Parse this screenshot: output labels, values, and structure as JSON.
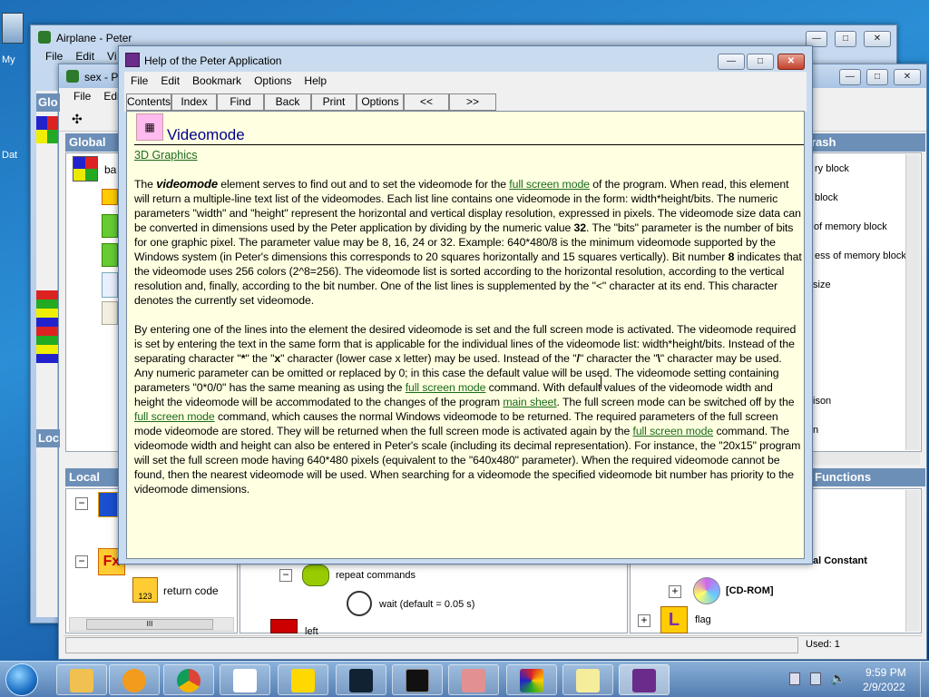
{
  "desktop": {
    "icon1": "My",
    "icon2": "Dat"
  },
  "airplane": {
    "title": "Airplane - Peter",
    "menu": [
      "File",
      "Edit",
      "Vi"
    ]
  },
  "sex": {
    "title": "sex - P",
    "menu": [
      "File",
      "Edi"
    ],
    "panels": {
      "global_left": "Glo",
      "global_var": "Global V",
      "local_left": "Loc",
      "local_var": "Local Va",
      "crash": "rash",
      "functions": "Functions"
    },
    "tree": {
      "item_ba": "ba",
      "return_code": "return code",
      "repeat": "repeat commands",
      "wait": "wait (default = 0.05 s)",
      "left": "left"
    },
    "right": {
      "r1": "ry block",
      "r2": "block",
      "r3": "of memory block",
      "r4": "ess of memory block",
      "r5": "size",
      "r6": "ison",
      "r7": "n",
      "const": "al Constant",
      "cdrom": "[CD-ROM]",
      "flag": "flag"
    },
    "status": "Used: 1",
    "scroll_label": "III"
  },
  "help": {
    "title": "Help of the Peter Application",
    "menu": [
      "File",
      "Edit",
      "Bookmark",
      "Options",
      "Help"
    ],
    "toolbar": [
      "Contents",
      "Index",
      "Find",
      "Back",
      "Print",
      "Options",
      "<<",
      ">>"
    ],
    "heading": "Videomode",
    "category_link": "3D Graphics",
    "p1a": "The ",
    "p1_em": "videomode",
    "p1b": " element serves to find out and to set the videomode for the ",
    "p1_link": "full screen mode",
    "p1c": " of the program. When read, this element will return a multiple-line text list of the videomodes. Each list line contains one videomode in the form: width*height/bits. The numeric parameters \"width\" and \"height\" represent the horizontal and vertical display resolution, expressed in pixels. The videomode size data can be converted in dimensions used by the Peter application by dividing by the numeric value ",
    "p1_b32": "32",
    "p1d": ". The \"bits\" parameter is the number of bits for one graphic pixel. The parameter value may be 8, 16, 24 or 32. Example: 640*480/8 is the minimum videomode supported by the Windows system (in Peter's dimensions this corresponds to 20 squares horizontally and 15 squares vertically). Bit number ",
    "p1_b8": "8",
    "p1e": " indicates that the videomode uses 256 colors (2^8=256). The videomode list is sorted according to the horizontal resolution, according to the vertical resolution and, finally, according to the bit number. One of the list lines is supplemented by the \"<\" character at its end. This character denotes the currently set videomode.",
    "p2a": "By entering one of the lines into the element the desired videomode is set and the full screen mode is activated. The videomode required is set by entering the text in the same form that is applicable for the individual lines of the videomode list: width*height/bits. Instead of the separating character \"",
    "p2_s1": "*",
    "p2b": "\" the \"",
    "p2_s2": "x",
    "p2c": "\" character (lower case x letter) may be used. Instead of the \"",
    "p2_s3": "/",
    "p2d": "\" character the \"",
    "p2_s4": "\\",
    "p2e": "\" character may be used. Any numeric parameter can be omitted or replaced by 0; in this case the default value will be used. The videomode setting containing parameters \"0*0/0\" has the same meaning as using the ",
    "p2_link1": "full screen mode",
    "p2f": " command. With default values of the videomode width and height the videomode will be accommodated to the changes of the program ",
    "p2_link2": "main sheet",
    "p2g": ". The full screen mode can be switched off by the ",
    "p2_link3": "full screen mode",
    "p2h": " command, which causes the normal Windows videomode to be returned. The required parameters of the full screen mode videomode are stored. They will be returned when the full screen mode is activated again by the ",
    "p2_link4": "full screen mode",
    "p2i": " command. The videomode width and height can also be entered in Peter's scale (including its decimal representation). For instance, the \"20x15\" program will set the full screen mode having 640*480 pixels (equivalent to the \"640x480\" parameter). When the required videomode cannot be found, then the nearest videomode will be used. When searching for a videomode the specified videomode bit number has priority to the videomode dimensions."
  },
  "taskbar": {
    "time": "9:59 PM",
    "date": "2/9/2022"
  }
}
